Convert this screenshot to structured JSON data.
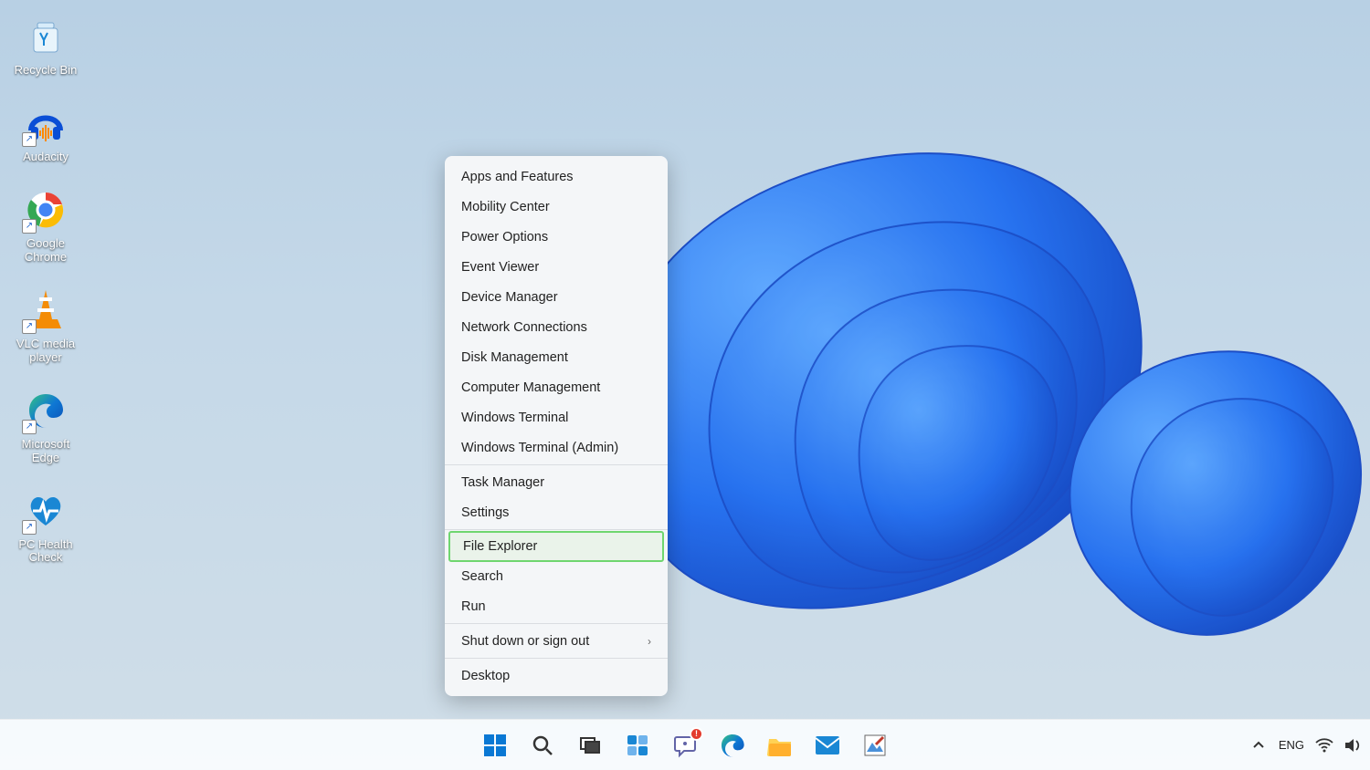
{
  "desktop_icons": [
    {
      "id": "recycle-bin",
      "label": "Recycle Bin",
      "shortcut": false
    },
    {
      "id": "audacity",
      "label": "Audacity",
      "shortcut": true
    },
    {
      "id": "google-chrome",
      "label": "Google\nChrome",
      "shortcut": true
    },
    {
      "id": "vlc",
      "label": "VLC media\nplayer",
      "shortcut": true
    },
    {
      "id": "ms-edge",
      "label": "Microsoft\nEdge",
      "shortcut": true
    },
    {
      "id": "pc-health",
      "label": "PC Health\nCheck",
      "shortcut": true
    }
  ],
  "winx_menu": {
    "groups": [
      [
        "Apps and Features",
        "Mobility Center",
        "Power Options",
        "Event Viewer",
        "Device Manager",
        "Network Connections",
        "Disk Management",
        "Computer Management",
        "Windows Terminal",
        "Windows Terminal (Admin)"
      ],
      [
        "Task Manager",
        "Settings"
      ],
      [
        "File Explorer",
        "Search",
        "Run"
      ],
      [
        "Shut down or sign out"
      ],
      [
        "Desktop"
      ]
    ],
    "highlighted_item": "File Explorer",
    "submenu_items": [
      "Shut down or sign out"
    ]
  },
  "taskbar": {
    "center_buttons": [
      "start",
      "search",
      "task-view",
      "widgets",
      "chat",
      "edge",
      "file-explorer",
      "mail",
      "image-editor"
    ],
    "chat_badge": "!",
    "right": {
      "show_hidden_icons": "^",
      "language": "ENG"
    }
  }
}
